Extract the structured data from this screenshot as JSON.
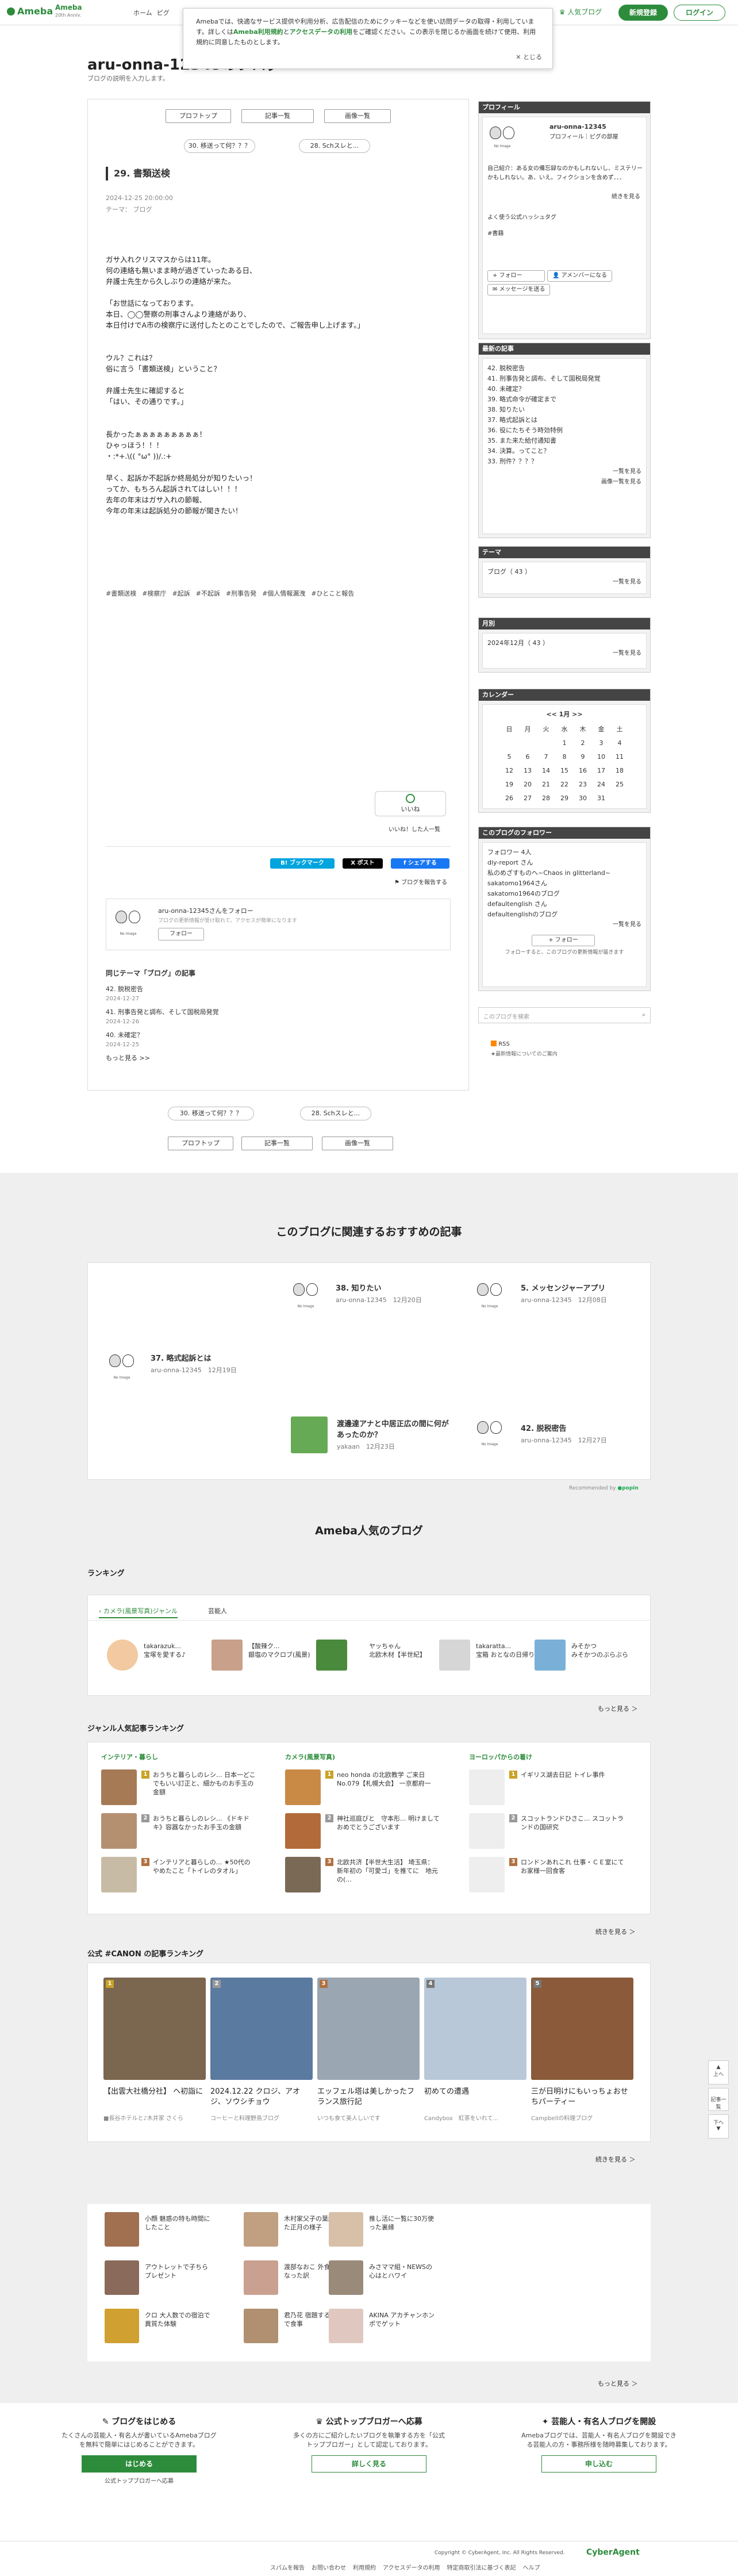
{
  "header": {
    "logo": "Ameba",
    "logo2": "Ameba",
    "logo2_sub": "20th Anniv.",
    "nav": [
      "ホーム",
      "ピグ"
    ],
    "popular": "人気ブログ",
    "register": "新規登録",
    "login": "ログイン"
  },
  "cookie": {
    "text_a": "Amebaでは、快適なサービス提供や利用分析、広告配信のためにクッキーなどを使い訪問データの取得・利用しています。詳しくは",
    "link1": "Ameba利用規約",
    "text_b": "と",
    "link2": "アクセスデータの利用",
    "text_c": "をご確認ください。この表示を閉じるか画面を続けて使用、利用規約に同意したものとします。",
    "close": "✕ とじる"
  },
  "blog": {
    "title": "aru-onna-12345のブログ",
    "desc": "ブログの説明を入力します。"
  },
  "toolbar": {
    "profile": "プロフトップ",
    "list": "記事一覧",
    "image": "画像一覧",
    "prev": "30. 移送って何？？？",
    "next": "28. Schスレと..."
  },
  "entry": {
    "title": "29. 書類送検",
    "date": "2024-12-25 20:00:00",
    "theme": "テーマ： ブログ",
    "body": "ガサ入れクリスマスからは11年。\n何の連絡も無いまま時が過ぎていったある日、\n弁護士先生から久しぶりの連絡が来た。\n\n「お世話になっております。\n本日、◯◯警察の刑事さんより連絡があり、\n本日付けでA市の検察庁に送付したとのことでしたので、ご報告申し上げます。」\n\n\nウル？これは？\n俗に言う「書類送検」ということ？\n\n弁護士先生に確認すると\n「はい、その通りです。」\n\n\n長かったぁぁぁぁぁぁぁぁぁ！\nひゃっほう！！！\n・:*+.\\(( °ω° ))/.:+\n\n早く、起訴か不起訴か終局処分が知りたいっ！\nってか、もちろん起訴されてはしい！！！\n去年の年末はガサ入れの節報、\n今年の年末は起訴処分の節報が聞きたい！",
    "tags": [
      "#書類送検",
      "#検察庁",
      "#起訴",
      "#不起訴",
      "#刑事告発",
      "#個人情報漏洩",
      "#ひとこと報告"
    ],
    "like": "いいね",
    "like_who": "いいね！した人一覧",
    "share_hatena": "B! ブックマーク",
    "share_x": "X ポスト",
    "share_fb": "f シェアする",
    "report": "ブログを報告する",
    "follow_text": "aru-onna-12345さんをフォロー",
    "follow_sub": "ブログの更新情報が受け取れて、アクセスが簡単になります",
    "follow_btn": "フォロー",
    "related_h": "同じテーマ「ブログ」の記事",
    "related": [
      {
        "t": "42. 脱税密告",
        "d": "2024-12-27"
      },
      {
        "t": "41. 刑事告発と調布、そして国税局発覚",
        "d": "2024-12-26"
      },
      {
        "t": "40. 未確定？",
        "d": "2024-12-25"
      }
    ],
    "related_more": "もっと見る >>"
  },
  "avatar": {
    "name": "No Image"
  },
  "side": {
    "profile_h": "プロフィール",
    "user": "aru-onna-12345",
    "user_sub": "プロフィール｜ピグの部屋",
    "bio": "自己紹介：ある女の備忘録なのかもしれないし、ミステリーかもしれない。あ、いえ。フィクションを含めず．．．",
    "bio_more": "続きを見る",
    "hashtag_h": "よく使う公式ハッシュタグ",
    "hashtag": "#書籍",
    "follow_btn": "+ フォロー",
    "amember": "アメンバーになる",
    "message": "メッセージを送る",
    "recent_h": "最新の記事",
    "recent": [
      "42. 脱税密告",
      "41. 刑事告発と調布、そして国税局発覚",
      "40. 未確定？",
      "39. 略式命令が確定まで",
      "38. 知りたい",
      "37. 略式起訴とは",
      "36. 役にたちそう時効特例",
      "35. また来た給付通知書",
      "34. 決算。ってこと？",
      "33. 刑件？？？？"
    ],
    "recent_more": "一覧を見る",
    "recent_img": "画像一覧を見る",
    "theme_h": "テーマ",
    "theme": "ブログ（ 43 ）",
    "theme_more": "一覧を見る",
    "month_h": "月別",
    "month": "2024年12月（ 43 ）",
    "month_more": "一覧を見る",
    "cal_h": "カレンダー",
    "cal_month": "1月",
    "cal_days": [
      "日",
      "月",
      "火",
      "水",
      "木",
      "金",
      "土"
    ],
    "cal_rows": [
      [
        "",
        "",
        "",
        "1",
        "2",
        "3",
        "4"
      ],
      [
        "5",
        "6",
        "7",
        "8",
        "9",
        "10",
        "11"
      ],
      [
        "12",
        "13",
        "14",
        "15",
        "16",
        "17",
        "18"
      ],
      [
        "19",
        "20",
        "21",
        "22",
        "23",
        "24",
        "25"
      ],
      [
        "26",
        "27",
        "28",
        "29",
        "30",
        "31",
        ""
      ]
    ],
    "fol_h": "このブログのフォロワー",
    "fol_count": "フォロワー 4人",
    "fol": [
      "diy-report さん",
      "私のめざすものへ~Chaos in glitterland~",
      "sakatomo1964さん",
      "sakatomo1964のブログ",
      "defaultenglish さん",
      "defaultenglishのブログ"
    ],
    "fol_more": "一覧を見る",
    "fol_btn": "+ フォロー",
    "fol_note": "フォローすると、このブログの更新情報が届きます",
    "search_ph": "このブログを検索",
    "rss": "RSS",
    "rss_note": "★最新情報についてのご案内"
  },
  "rec": {
    "h": "このブログに関連するおすすめの記事",
    "items": [
      {
        "t": "38. 知りたい",
        "s": "aru-onna-12345　12月20日"
      },
      {
        "t": "5. メッセンジャーアプリ",
        "s": "aru-onna-12345　12月08日"
      },
      {
        "t": "37. 略式起訴とは",
        "s": "aru-onna-12345　12月19日"
      },
      {
        "t": "渡邊達アナと中居正広の間に何があったのか？",
        "s": "yakaan　12月23日"
      },
      {
        "t": "42. 脱税密告",
        "s": "aru-onna-12345　12月27日"
      }
    ],
    "powered": "Recommended by"
  },
  "pop": {
    "h": "Ameba人気のブログ",
    "ranking": "ランキング",
    "tab1": "カメラ(風景写真)ジャンル",
    "tab2": "芸能人",
    "r1": [
      {
        "a": "takarazuk...",
        "b": "宝塚を愛する♪"
      },
      {
        "a": "【酸辣ク...",
        "b": "銀塩のマクロブ(風景)"
      },
      {
        "a": "ヤッちゃん",
        "b": "北欧木材【半世紀】"
      },
      {
        "a": "takaratta...",
        "b": "宝箱 おとなの日帰り"
      },
      {
        "a": "みそかつ",
        "b": "みそかつのぶらぶら"
      }
    ],
    "more": "もっと見る ＞",
    "genre_h": "ジャンル人気記事ランキング",
    "col1": "インテリア・暮らし",
    "col2": "カメラ(風景写真)",
    "col3": "ヨーロッパからの着け",
    "g1": [
      "おうちと暮らしのレシ... 日本一どこでもいい訂正と、細かものお手玉の金額",
      "おうちと暮らしのレシ... 《ドキドキ》容器なかったお手玉の金額",
      "インテリアと暮らしの... ★50代のやめたこと「トイレのタオル」"
    ],
    "g2": [
      "neo honda の北欧教学 ご来日 No.079【札幌大会】 一京都府一",
      "神社巡庭びと　守本形... 明けましておめでとうございます",
      "北欧共济【半世大生活】 埼玉県： 新年初の「可愛ゴ」を推てに　地元 の(..."
    ],
    "g3": [
      "イギリス湖去日記 トイレ事件",
      "スコットランドひさこ... スコットランドの国研究",
      "ロンドンあれこれ 仕事・ＣＥ室にてお家様一回食客"
    ],
    "next": "続きを見る ＞",
    "canon_h": "公式 #CANON の記事ランキング",
    "canon": [
      {
        "t": "【出雲大社橋分社】 ヘ初詣に",
        "s": "■長谷ホテルと♪木井家 さくら"
      },
      {
        "t": "2024.12.22 クロジ、アオジ、ソウシチョウ",
        "s": "コーヒーと料理野鳥ブログ"
      },
      {
        "t": "エッフェル塔は美しかったフランス旅行記",
        "s": "いつも食て美人しいです"
      },
      {
        "t": "初めての遭遇",
        "s": "Candybox　紅茶をいれて..."
      },
      {
        "t": "三が日明けにもいっちょおせちパーティー",
        "s": "Campbellの料理ブログ"
      }
    ],
    "canon_more": "続きを見る ＞",
    "grid": [
      "小顔 魅惑の特も時間にしたこと",
      "木村家父子の葉細工した正月の様子",
      "推し活に一覧に30万使った裏縁",
      "アウトレットで子ちらプレゼント",
      "渡部なおこ 外食しなくなった訳",
      "みさママ組・NEWSの心はとハワイ",
      "クロ 大人数での宿泊で異質た体験",
      "君乃花 宿題する娘の隣で食事",
      "AKINA アカチャンホンポでゲット"
    ],
    "grid_more": "もっと見る ＞"
  },
  "footer": {
    "c1_h": "ブログをはじめる",
    "c1_t": "たくさんの芸能人・有名人が書いているAmebaブログを無料で簡単にはじめることができます。",
    "c1_b": "はじめる",
    "c1_n": "公式トップブロガーへ応募",
    "c2_h": "公式トップブロガーへ応募",
    "c2_t": "多くの方にご紹介したいブログを執筆する方を「公式トップブロガー」として認定しております。",
    "c2_b": "詳しく見る",
    "c3_h": "芸能人・有名人ブログを開設",
    "c3_t": "Amebaブログでは、芸能人・有名人ブログを開設できる芸能人の方・事務所様を随時募集しております。",
    "c3_b": "申し込む",
    "links": [
      "スパムを報告",
      "お問い合わせ",
      "利用規約",
      "アクセスデータの利用",
      "特定商取引法に基づく表記",
      "ヘルプ"
    ],
    "copy": "Copyright © CyberAgent, Inc. All Rights Reserved.",
    "brand": "CyberAgent"
  },
  "scroll": [
    "上へ",
    "記事一覧",
    "下へ"
  ]
}
